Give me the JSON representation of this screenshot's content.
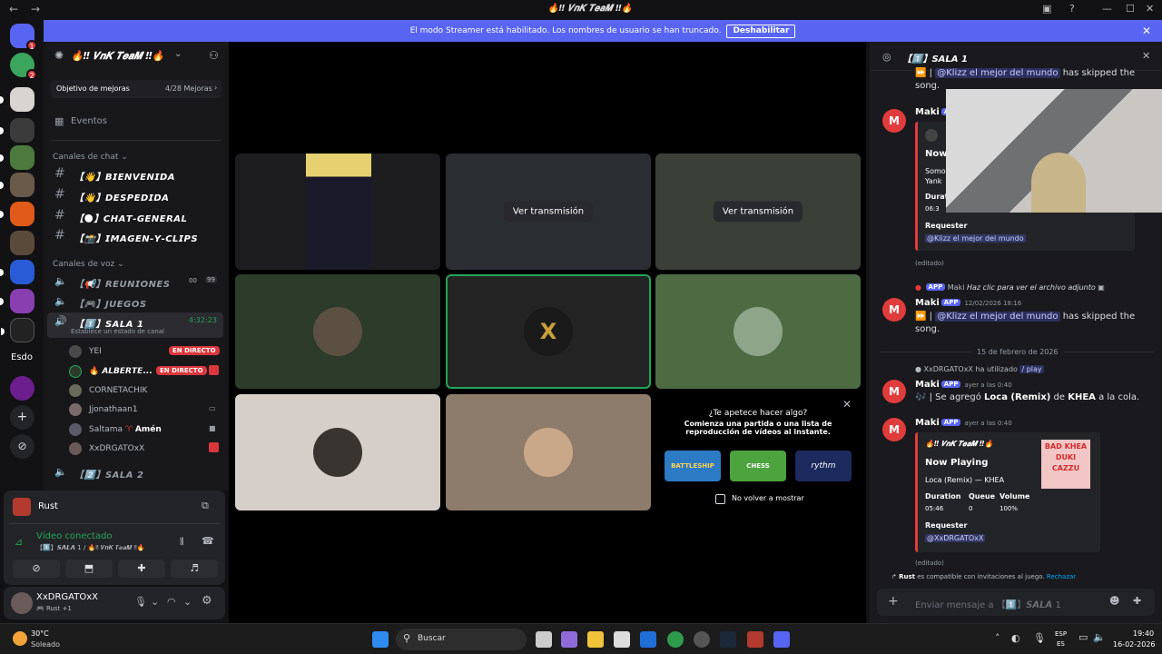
{
  "titlebar": {
    "title": "🔥‼ 𝑽𝒏𝑲 𝑻𝒆𝒂𝑴 ‼🔥",
    "nav_back": "←",
    "nav_fwd": "→"
  },
  "banner": {
    "text": "El modo Streamer está habilitado. Los nombres de usuario se han truncado.",
    "button": "Deshabilitar"
  },
  "server": {
    "name": "🔥‼ 𝑽𝒏𝑲 𝑻𝒆𝒂𝑴 ‼🔥",
    "goal_label": "Objetivo de mejoras",
    "goal_progress": "4/28 Mejoras",
    "events": "Eventos",
    "chat_category": "Canales de chat",
    "voice_category": "Canales de voz",
    "text_channels": [
      "【👋】𝘽𝙄𝙀𝙉𝙑𝙀𝙉𝙄𝘿𝘼",
      "【👋】𝘿𝙀𝙎𝙋𝙀𝘿𝙄𝘿𝘼",
      "【🌑】𝘾𝙃𝘼𝙏-𝙂𝙀𝙉𝙀𝙍𝘼𝙇",
      "【📸】𝙄𝙈𝘼𝙂𝙀𝙉-𝙔-𝘾𝙇𝙄𝙋𝙎"
    ],
    "voice_channels": {
      "reuniones": "【📢】𝙍𝙀𝙐𝙉𝙄𝙊𝙉𝙀𝙎",
      "reuniones_count_a": "00",
      "reuniones_count_b": "99",
      "juegos": "【🎮】𝙅𝙐𝙀𝙂𝙊𝙎",
      "sala1": "【1️⃣】𝙎𝘼𝙇𝘼 1",
      "sala1_timer": "4:32:23",
      "sala1_status": "Establece un estado de canal",
      "sala2": "【2️⃣】𝙎𝘼𝙇𝘼 2"
    },
    "voice_users": [
      {
        "name": "YEI",
        "live": "EN DIRECTO"
      },
      {
        "name": "🔥 𝘼𝙇𝘽𝙀𝙍𝙏𝙀...",
        "live": "EN DIRECTO"
      },
      {
        "name": "CORNETACHIK",
        "live": ""
      },
      {
        "name": "Jjonathaan1",
        "live": ""
      },
      {
        "name": "Saltama",
        "extra": "Amén",
        "live": ""
      },
      {
        "name": "XxDRGATOxX",
        "live": ""
      }
    ]
  },
  "voice_panel": {
    "activity": "Rust",
    "status": "Vídeo conectado",
    "location": "【1️⃣】𝙎𝘼𝙇𝘼 1 / 🔥‼ 𝑽𝒏𝑲 𝑻𝒆𝒂𝑴 ‼🔥"
  },
  "user_panel": {
    "name": "XxDRGATOxX",
    "status": "🎮 Rust +1"
  },
  "stage": {
    "watch_label": "Ver transmisión",
    "watch_label_2": "Ver transmisión",
    "activity_title": "¿Te apetece hacer algo?",
    "activity_desc": "Comienza una partida o una lista de reproducción de vídeos al instante.",
    "no_show": "No volver a mostrar",
    "activity_tiles": [
      "BATTLESHIP",
      "CHESS",
      "rythm"
    ]
  },
  "thread": {
    "title": "【1️⃣】𝙎𝘼𝙇𝘼 1",
    "m1_text_a": "⏩ | ",
    "m1_mention": "@Klizz el mejor del mundo",
    "m1_text_b": " has skipped the song.",
    "m2_name": "Maki",
    "m2_app": "APP",
    "embed1_title": "Now",
    "embed1_song_a": "Somo",
    "embed1_song_b": "Yank",
    "embed1_duration": "Durat",
    "embed1_time": "06:3",
    "embed1_req_label": "Requester",
    "embed1_req": "@Klizz el mejor del mundo",
    "edited": "(editado)",
    "reply_text": "Maki",
    "reply_click": "Haz clic para ver el archivo adjunto",
    "m3_name": "Maki",
    "m3_app": "APP",
    "m3_ts": "12/02/2026 18:16",
    "m3_text_a": "⏩ | ",
    "m3_mention": "@Klizz el mejor del mundo",
    "m3_text_b": " has skipped the song.",
    "date_divider": "15 de febrero de 2026",
    "used_user": "XxDRGATOxX",
    "used_text": "ha utilizado",
    "used_cmd": "/ play",
    "m4_name": "Maki",
    "m4_app": "APP",
    "m4_ts": "ayer a las 0:40",
    "m4_text_a": "🎶 | Se agregó ",
    "m4_song": "Loca (Remix)",
    "m4_mid": " de ",
    "m4_artist": "KHEA",
    "m4_text_b": " a la cola.",
    "m5_name": "Maki",
    "m5_app": "APP",
    "m5_ts": "ayer a las 0:40",
    "embed2_server": "🔥‼ 𝑽𝒏𝑲 𝑻𝒆𝒂𝑴 ‼🔥",
    "embed2_title": "Now Playing",
    "embed2_song": "Loca (Remix) — KHEA",
    "embed2_dur_label": "Duration",
    "embed2_dur": "05:46",
    "embed2_queue_label": "Queue",
    "embed2_queue": "0",
    "embed2_vol_label": "Volume",
    "embed2_vol": "100%",
    "embed2_req_label": "Requester",
    "embed2_req": "@XxDRGATOxX",
    "cover_text": "BAD KHEA DUKI CAZZU",
    "edited2": "(editado)",
    "invite_a": "Rust",
    "invite_b": "es compatible con invitaciones al juego.",
    "invite_link": "Rechazar",
    "input_placeholder": "Enviar mensaje a 【1️⃣】𝙎𝘼𝙇𝘼 1"
  },
  "taskbar": {
    "weather_temp": "30°C",
    "weather_desc": "Soleado",
    "search": "Buscar",
    "lang_a": "ESP",
    "lang_b": "ES",
    "time": "19:40",
    "date": "16-02-2026"
  },
  "sidebar_extra": {
    "esdo": "Esdo"
  },
  "colors": {
    "accent": "#5865f2",
    "live": "#da373c",
    "green": "#23a55a",
    "maki": "#e03c3c"
  }
}
